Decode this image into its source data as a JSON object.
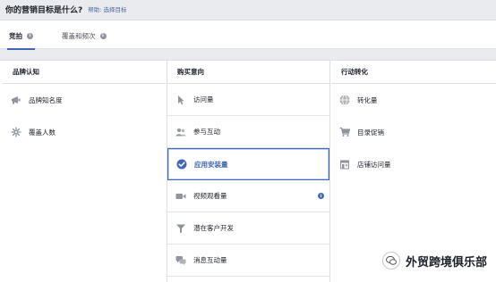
{
  "header": {
    "question": "你的营销目标是什么?",
    "help_link": "帮助: 选择目标"
  },
  "tabs": [
    {
      "label": "竞拍",
      "active": true
    },
    {
      "label": "覆盖和频次",
      "active": false
    }
  ],
  "columns": [
    {
      "heading": "品牌认知",
      "items": [
        {
          "label": "品牌知名度",
          "icon": "megaphone-icon"
        },
        {
          "label": "覆盖人数",
          "icon": "reach-icon"
        }
      ]
    },
    {
      "heading": "购买意向",
      "items": [
        {
          "label": "访问量",
          "icon": "cursor-icon"
        },
        {
          "label": "参与互动",
          "icon": "people-icon"
        },
        {
          "label": "应用安装量",
          "icon": "check-circle-icon",
          "selected": true
        },
        {
          "label": "视频观看量",
          "icon": "video-camera-icon"
        },
        {
          "label": "潜在客户开发",
          "icon": "funnel-icon"
        },
        {
          "label": "消息互动量",
          "icon": "chat-bubbles-icon"
        }
      ]
    },
    {
      "heading": "行动转化",
      "items": [
        {
          "label": "转化量",
          "icon": "globe-icon"
        },
        {
          "label": "目录促销",
          "icon": "cart-icon"
        },
        {
          "label": "店铺访问量",
          "icon": "store-icon"
        }
      ]
    }
  ],
  "watermark": {
    "text": "外贸跨境俱乐部"
  },
  "colors": {
    "accent": "#4267b2",
    "icon_gray": "#90949c",
    "background": "#e9ebee"
  }
}
